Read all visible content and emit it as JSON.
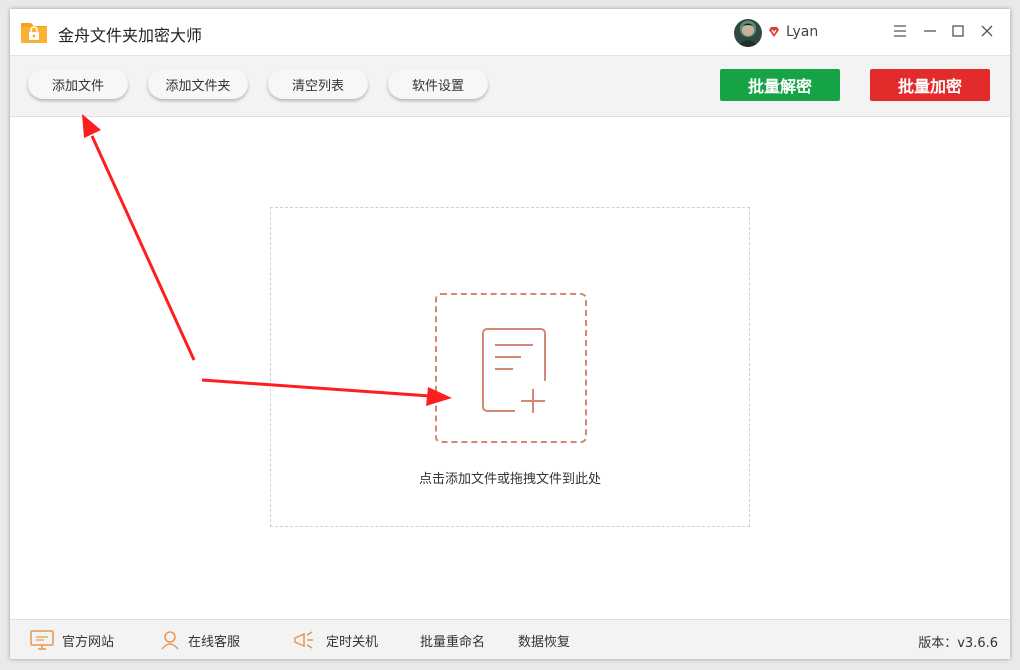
{
  "app": {
    "title": "金舟文件夹加密大师"
  },
  "user": {
    "name": "Lyan"
  },
  "toolbar": {
    "add_file": "添加文件",
    "add_folder": "添加文件夹",
    "clear_list": "清空列表",
    "settings": "软件设置",
    "batch_decrypt": "批量解密",
    "batch_encrypt": "批量加密"
  },
  "main": {
    "drop_hint": "点击添加文件或拖拽文件到此处"
  },
  "statusbar": {
    "website": "官方网站",
    "support": "在线客服",
    "shutdown": "定时关机",
    "rename": "批量重命名",
    "recovery": "数据恢复",
    "version": "版本：v3.6.6"
  },
  "colors": {
    "decrypt": "#15a346",
    "encrypt": "#e32b2b",
    "accent": "#d38874",
    "annotation_arrow": "#ff1e1e"
  }
}
